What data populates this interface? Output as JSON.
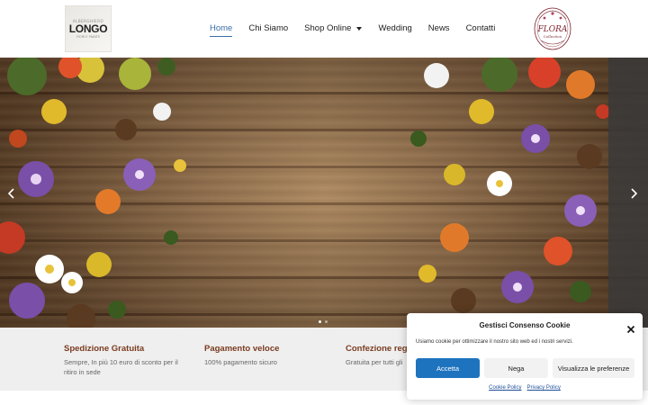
{
  "header": {
    "logo_left": {
      "top_text": "ALBERGHIERO",
      "brand": "LONGO",
      "bottom_text": "FIORI E PIANTE"
    },
    "nav": [
      {
        "label": "Home",
        "active": true
      },
      {
        "label": "Chi Siamo",
        "active": false
      },
      {
        "label": "Shop Online",
        "active": false,
        "has_dropdown": true
      },
      {
        "label": "Wedding",
        "active": false
      },
      {
        "label": "News",
        "active": false
      },
      {
        "label": "Contatti",
        "active": false
      }
    ],
    "logo_right": {
      "brand": "FLORA",
      "tagline": "Collection"
    }
  },
  "hero": {
    "icons": {
      "prev": "chevron-left-icon",
      "next": "chevron-right-icon"
    },
    "dots_total": 2,
    "dots_active": 1
  },
  "features": [
    {
      "title": "Spedizione Gratuita",
      "text": "Sempre, In più 10 euro di sconto per il ritiro in sede"
    },
    {
      "title": "Pagamento veloce",
      "text": "100% pagamento sicuro"
    },
    {
      "title": "Confezione reg",
      "text": "Gratuita per tutti gli"
    }
  ],
  "cookie": {
    "title": "Gestisci Consenso Cookie",
    "text": "Usiamo cookie per ottimizzare il nostro sito web ed i nostri servizi.",
    "accept": "Accetta",
    "deny": "Nega",
    "preferences": "Visualizza le preferenze",
    "links": [
      "Cookie Policy",
      "Privacy Policy"
    ],
    "accent_color": "#1e73be"
  },
  "colors": {
    "nav_active": "#3a6ea5",
    "feature_title": "#7a3b1f",
    "features_bg": "#efefef"
  }
}
